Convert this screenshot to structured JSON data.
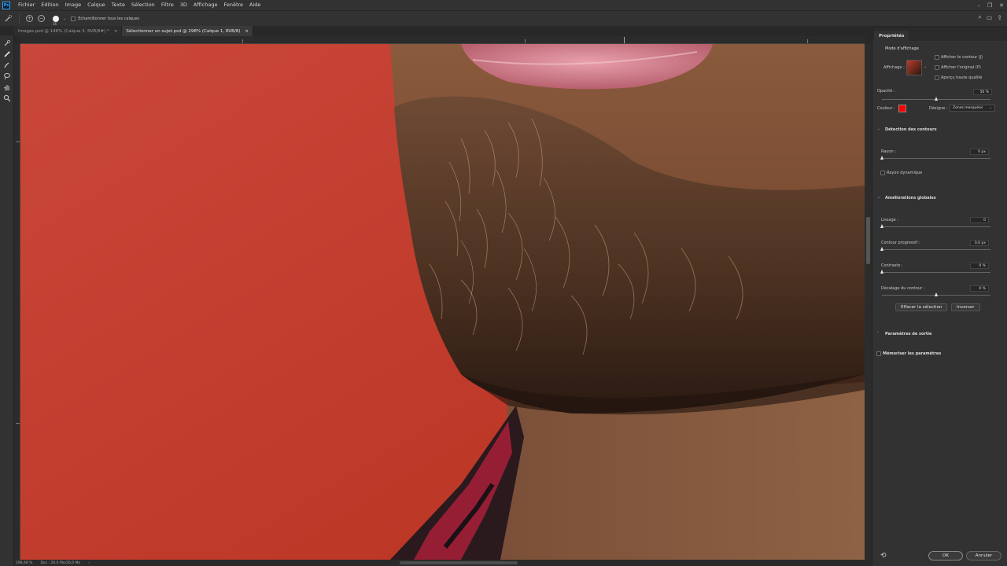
{
  "app": {
    "logo": "Ps"
  },
  "menu": [
    "Fichier",
    "Edition",
    "Image",
    "Calque",
    "Texte",
    "Sélection",
    "Filtre",
    "3D",
    "Affichage",
    "Fenêtre",
    "Aide"
  ],
  "options": {
    "brush_size": "36",
    "sample_all_label": "Echantillonner tous les calques"
  },
  "tabs": [
    {
      "label": "Images.psd @ 146% (Calque 3, RVB/8#) *",
      "close": "×"
    },
    {
      "label": "Sélectionner un sujet.psd @ 298% (Calque 1, RVB/8)",
      "close": "×"
    }
  ],
  "status": {
    "zoom": "298,48 %",
    "doc": "Doc : 26,0 Mo/26,0 Mo",
    "arrow": "›"
  },
  "panel": {
    "title": "Propriétés",
    "view_mode": {
      "title": "Mode d'affichage",
      "display_label": "Affichage :",
      "show_edge": "Afficher le contour (J)",
      "show_original": "Afficher l'original (P)",
      "hq_preview": "Aperçu haute qualité"
    },
    "opacity": {
      "label": "Opacité :",
      "value": "50 %",
      "percent": 50
    },
    "color": {
      "label": "Couleur :",
      "swatch": "#ff0000",
      "indicates_label": "Désigne :",
      "indicates_value": "Zones masquées"
    },
    "edge_detection": {
      "title": "Détection des contours",
      "radius_label": "Rayon :",
      "radius_value": "0 px",
      "radius_percent": 0,
      "smart_radius": "Rayon dynamique"
    },
    "global": {
      "title": "Améliorations globales",
      "smooth_label": "Lissage :",
      "smooth_value": "0",
      "smooth_percent": 0,
      "feather_label": "Contour progressif :",
      "feather_value": "0,0 px",
      "feather_percent": 0,
      "contrast_label": "Contraste :",
      "contrast_value": "0 %",
      "contrast_percent": 0,
      "shift_label": "Décalage du contour :",
      "shift_value": "0 %",
      "shift_percent": 50,
      "clear_btn": "Effacer la sélection",
      "invert_btn": "Inverser"
    },
    "output": {
      "title": "Paramètres de sortie"
    },
    "remember": "Mémoriser les paramètres",
    "ok": "OK",
    "cancel": "Annuler"
  }
}
